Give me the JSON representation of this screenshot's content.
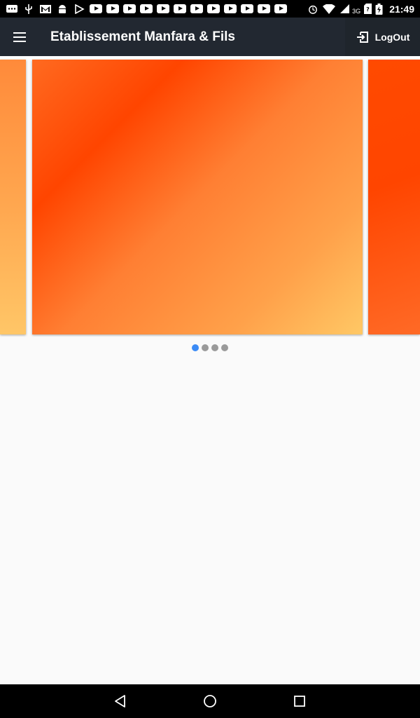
{
  "status_bar": {
    "time": "21:49",
    "network": "3G",
    "left_icons": [
      "message-icon",
      "usb-icon",
      "gmail-icon",
      "android-icon",
      "play-store-icon",
      "youtube-icon"
    ],
    "youtube_count": 12
  },
  "app_bar": {
    "title": "Etablissement Manfara & Fils",
    "logout_label": "LogOut",
    "background": "#222831"
  },
  "carousel": {
    "slide_count": 4,
    "active_index": 0,
    "colors": [
      "#ff4500",
      "#ff7f33",
      "#ffc865"
    ],
    "active_dot_color": "#3b8bf5",
    "inactive_dot_color": "#9a9a9a"
  },
  "nav_bar": {
    "buttons": [
      "back",
      "home",
      "recents"
    ]
  }
}
